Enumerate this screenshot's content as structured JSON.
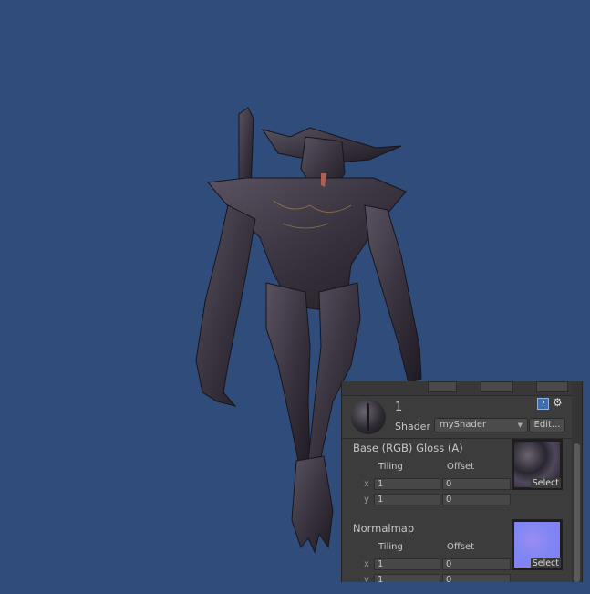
{
  "scene": {
    "background_color": "#2f4c7a",
    "model": "dark horned demon creature"
  },
  "inspector": {
    "material_name": "1",
    "shader_label": "Shader",
    "shader_value": "myShader",
    "edit_button": "Edit...",
    "help_icon": "help-book-icon",
    "settings_icon": "gear-icon",
    "help_glyph": "?",
    "gear_glyph": "⚙",
    "dropdown_arrow": "▼",
    "properties": [
      {
        "title": "Base (RGB) Gloss (A)",
        "tiling_label": "Tiling",
        "offset_label": "Offset",
        "x_label": "x",
        "y_label": "y",
        "tiling_x": "1",
        "tiling_y": "1",
        "offset_x": "0",
        "offset_y": "0",
        "select_label": "Select"
      },
      {
        "title": "Normalmap",
        "tiling_label": "Tiling",
        "offset_label": "Offset",
        "x_label": "x",
        "y_label": "y",
        "tiling_x": "1",
        "tiling_y": "1",
        "offset_x": "0",
        "offset_y": "0",
        "select_label": "Select"
      }
    ]
  }
}
